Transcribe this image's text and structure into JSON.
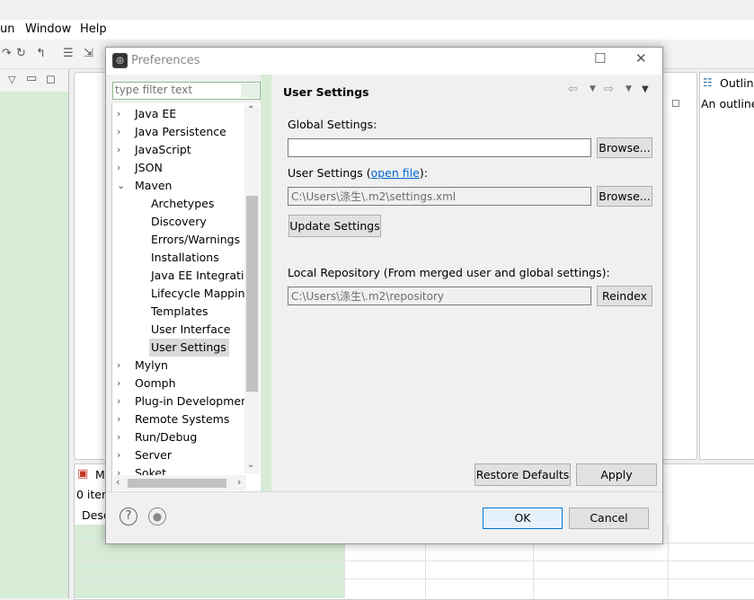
{
  "eclipse": {
    "menu": [
      "un",
      "Window",
      "Help"
    ],
    "bottom_tab_label": "M",
    "items_count": "0 item",
    "col_header": "Desc",
    "outline_title": "Outline",
    "outline_message": "An outline"
  },
  "dialog": {
    "title": "Preferences",
    "filter_placeholder": "type filter text",
    "tree": [
      {
        "label": "Java EE",
        "level": 0,
        "expanded": false
      },
      {
        "label": "Java Persistence",
        "level": 0,
        "expanded": false
      },
      {
        "label": "JavaScript",
        "level": 0,
        "expanded": false
      },
      {
        "label": "JSON",
        "level": 0,
        "expanded": false
      },
      {
        "label": "Maven",
        "level": 0,
        "expanded": true
      },
      {
        "label": "Archetypes",
        "level": 1
      },
      {
        "label": "Discovery",
        "level": 1
      },
      {
        "label": "Errors/Warnings",
        "level": 1
      },
      {
        "label": "Installations",
        "level": 1
      },
      {
        "label": "Java EE Integration",
        "level": 1
      },
      {
        "label": "Lifecycle Mapping",
        "level": 1
      },
      {
        "label": "Templates",
        "level": 1
      },
      {
        "label": "User Interface",
        "level": 1
      },
      {
        "label": "User Settings",
        "level": 1,
        "selected": true
      },
      {
        "label": "Mylyn",
        "level": 0,
        "expanded": false
      },
      {
        "label": "Oomph",
        "level": 0,
        "expanded": false
      },
      {
        "label": "Plug-in Development",
        "level": 0,
        "expanded": false
      },
      {
        "label": "Remote Systems",
        "level": 0,
        "expanded": false
      },
      {
        "label": "Run/Debug",
        "level": 0,
        "expanded": false
      },
      {
        "label": "Server",
        "level": 0,
        "expanded": false
      },
      {
        "label": "Soket",
        "level": 0,
        "expanded": false
      }
    ],
    "page_title": "User Settings",
    "global_settings_label": "Global Settings:",
    "global_settings_value": "",
    "browse_label": "Browse...",
    "user_settings_label": "User Settings (",
    "open_file_link": "open file",
    "user_settings_label_end": "):",
    "user_settings_value": "C:\\Users\\涤生\\.m2\\settings.xml",
    "update_settings_label": "Update Settings",
    "local_repo_label": "Local Repository (From merged user and global settings):",
    "local_repo_value": "C:\\Users\\涤生\\.m2\\repository",
    "reindex_label": "Reindex",
    "restore_defaults_label": "Restore Defaults",
    "apply_label": "Apply",
    "ok_label": "OK",
    "cancel_label": "Cancel"
  },
  "colors": {
    "accent": "#0078d7",
    "selection": "#d9d9d9",
    "green_tint": "#d7ecd6",
    "link": "#0066cc"
  }
}
